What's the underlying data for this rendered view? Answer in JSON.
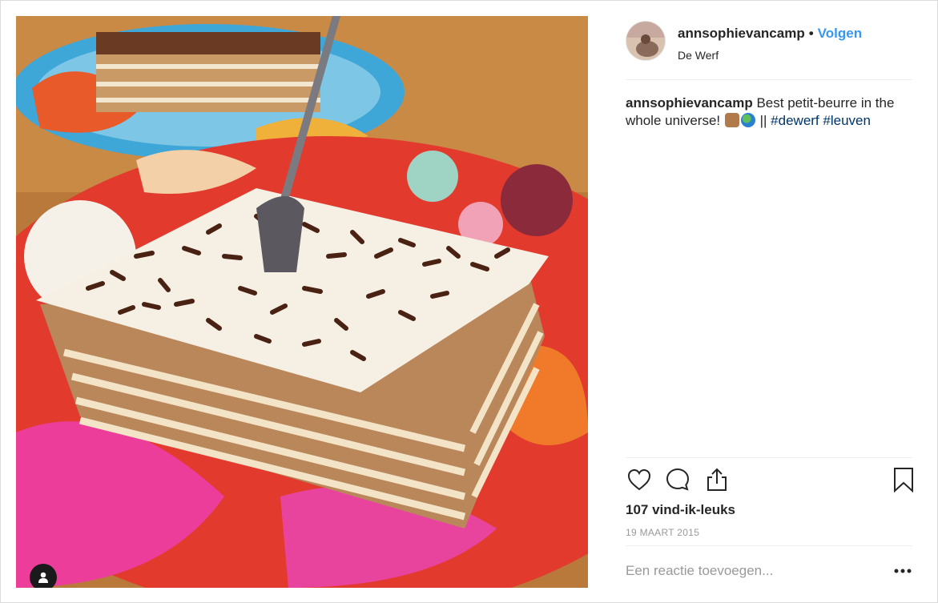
{
  "post": {
    "username": "annsophievancamp",
    "separator": "•",
    "follow_label": "Volgen",
    "location": "De Werf",
    "caption": {
      "username": "annsophievancamp",
      "text_1": "Best petit-beurre in the whole universe!",
      "separator": "||",
      "hashtag_1": "#dewerf",
      "hashtag_2": "#leuven"
    },
    "likes": "107 vind-ik-leuks",
    "date": "19 MAART 2015",
    "comment_placeholder": "Een reactie toevoegen..."
  },
  "icons": {
    "like": "heart-icon",
    "comment": "comment-icon",
    "share": "share-icon",
    "save": "bookmark-icon",
    "more": "more-dots-icon",
    "tag": "user-tag-icon"
  },
  "colors": {
    "link": "#3897f0",
    "hashtag": "#003569",
    "muted": "#999999",
    "text": "#262626"
  }
}
